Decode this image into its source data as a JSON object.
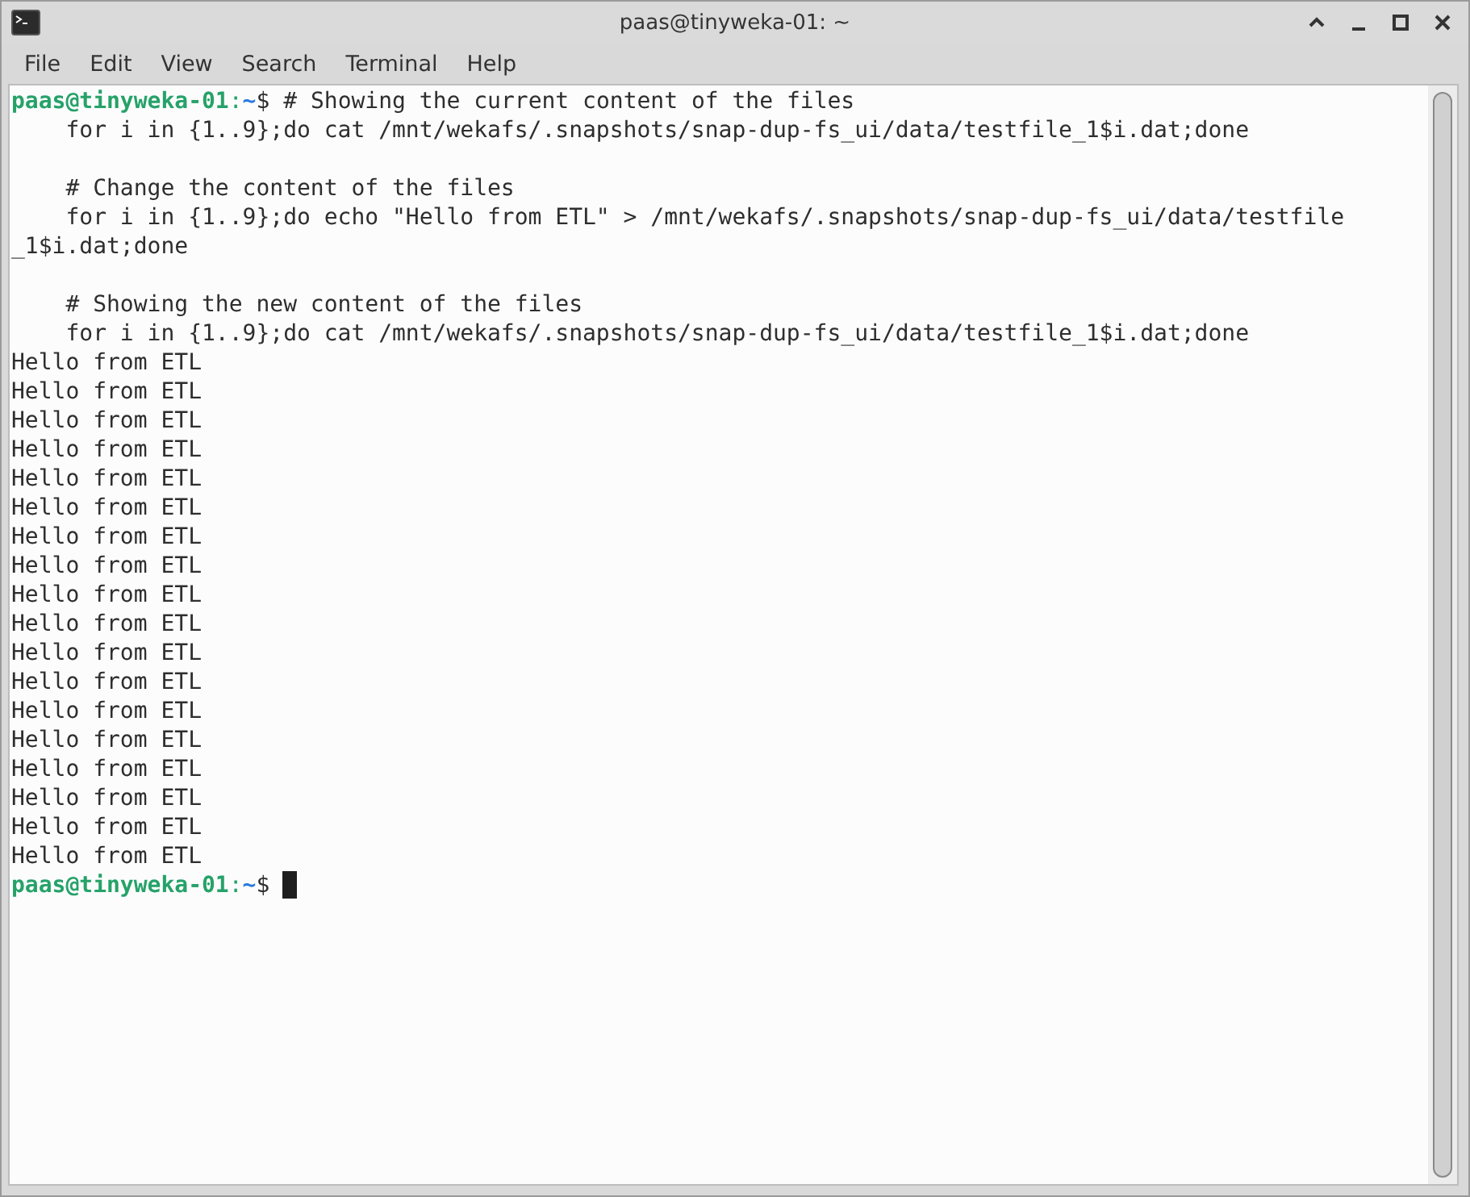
{
  "window": {
    "title": "paas@tinyweka-01: ~"
  },
  "menu": [
    "File",
    "Edit",
    "View",
    "Search",
    "Terminal",
    "Help"
  ],
  "terminal": {
    "lines": [
      {
        "kind": "prompt",
        "user_host": "paas@tinyweka-01",
        "separator": ":",
        "path": "~",
        "symbol": "$",
        "command": "# Showing the current content of the files"
      },
      {
        "kind": "output",
        "text": "    for i in {1..9};do cat /mnt/wekafs/.snapshots/snap-dup-fs_ui/data/testfile_1$i.dat;done"
      },
      {
        "kind": "blank"
      },
      {
        "kind": "output",
        "text": "    # Change the content of the files"
      },
      {
        "kind": "output",
        "text": "    for i in {1..9};do echo \"Hello from ETL\" > /mnt/wekafs/.snapshots/snap-dup-fs_ui/data/testfile"
      },
      {
        "kind": "output",
        "text": "_1$i.dat;done"
      },
      {
        "kind": "blank"
      },
      {
        "kind": "output",
        "text": "    # Showing the new content of the files"
      },
      {
        "kind": "output",
        "text": "    for i in {1..9};do cat /mnt/wekafs/.snapshots/snap-dup-fs_ui/data/testfile_1$i.dat;done"
      },
      {
        "kind": "output",
        "text": "Hello from ETL"
      },
      {
        "kind": "output",
        "text": "Hello from ETL"
      },
      {
        "kind": "output",
        "text": "Hello from ETL"
      },
      {
        "kind": "output",
        "text": "Hello from ETL"
      },
      {
        "kind": "output",
        "text": "Hello from ETL"
      },
      {
        "kind": "output",
        "text": "Hello from ETL"
      },
      {
        "kind": "output",
        "text": "Hello from ETL"
      },
      {
        "kind": "output",
        "text": "Hello from ETL"
      },
      {
        "kind": "output",
        "text": "Hello from ETL"
      },
      {
        "kind": "output",
        "text": "Hello from ETL"
      },
      {
        "kind": "output",
        "text": "Hello from ETL"
      },
      {
        "kind": "output",
        "text": "Hello from ETL"
      },
      {
        "kind": "output",
        "text": "Hello from ETL"
      },
      {
        "kind": "output",
        "text": "Hello from ETL"
      },
      {
        "kind": "output",
        "text": "Hello from ETL"
      },
      {
        "kind": "output",
        "text": "Hello from ETL"
      },
      {
        "kind": "output",
        "text": "Hello from ETL"
      },
      {
        "kind": "output",
        "text": "Hello from ETL"
      },
      {
        "kind": "prompt",
        "user_host": "paas@tinyweka-01",
        "separator": ":",
        "path": "~",
        "symbol": "$",
        "cursor": true
      }
    ]
  }
}
